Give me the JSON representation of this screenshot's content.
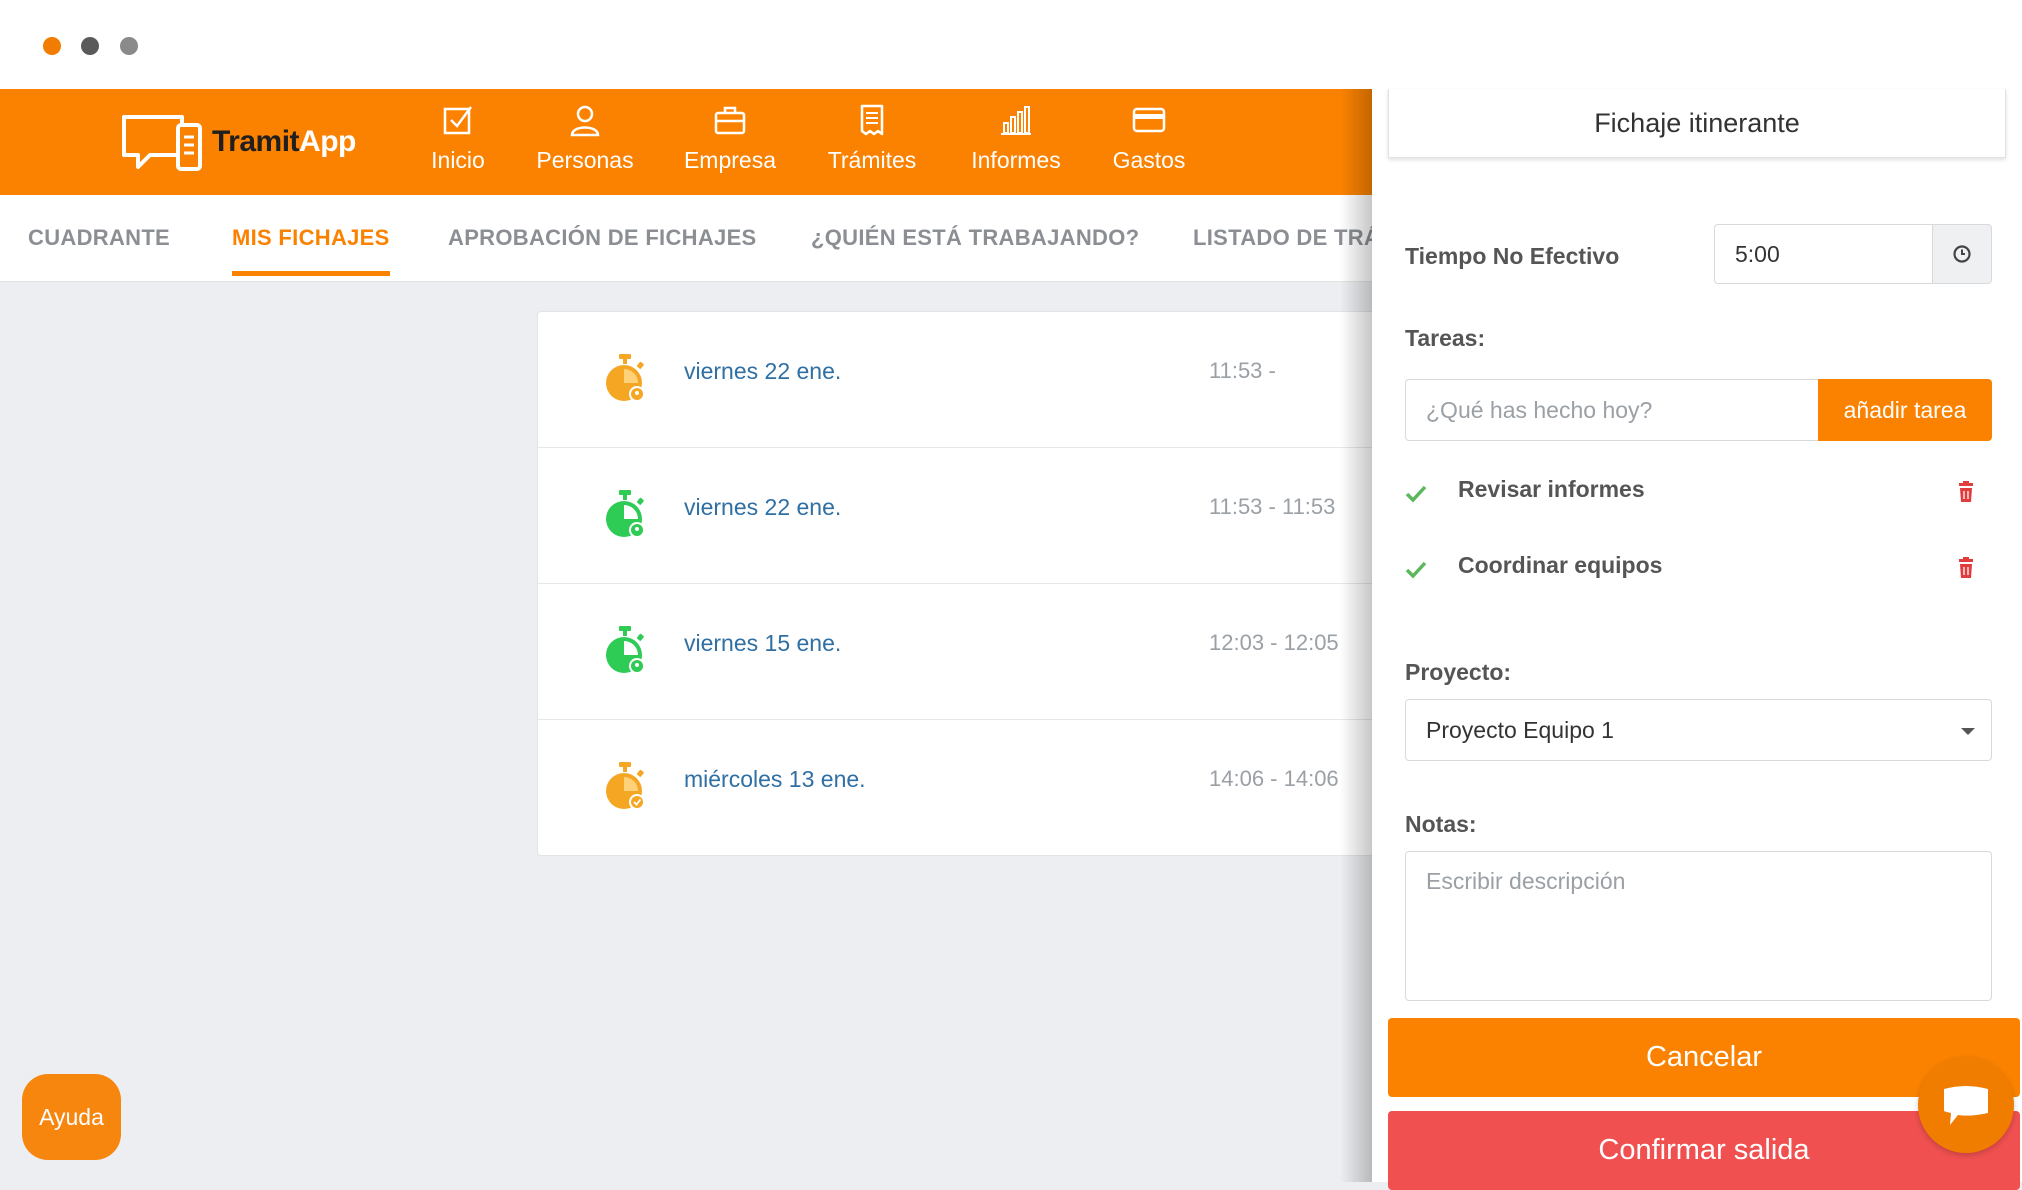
{
  "colors": {
    "accent": "#fb8200",
    "danger": "#f05050",
    "link": "#2f6fa3",
    "success": "#2ecc55",
    "warning": "#f5a623"
  },
  "brand": {
    "logo_part1": "Tramit",
    "logo_part2": "App"
  },
  "nav": [
    {
      "label": "Inicio",
      "icon": "checkbox-icon"
    },
    {
      "label": "Personas",
      "icon": "person-icon"
    },
    {
      "label": "Empresa",
      "icon": "briefcase-icon"
    },
    {
      "label": "Trámites",
      "icon": "receipt-icon"
    },
    {
      "label": "Informes",
      "icon": "bar-chart-icon"
    },
    {
      "label": "Gastos",
      "icon": "credit-card-icon"
    }
  ],
  "tabs": [
    {
      "label": "CUADRANTE",
      "active": false
    },
    {
      "label": "MIS FICHAJES",
      "active": true
    },
    {
      "label": "APROBACIÓN DE FICHAJES",
      "active": false
    },
    {
      "label": "¿QUIÉN ESTÁ TRABAJANDO?",
      "active": false
    },
    {
      "label": "LISTADO DE TRÁ",
      "active": false
    }
  ],
  "records": [
    {
      "date": "viernes 22 ene.",
      "time": "11:53 -",
      "status_icon": "stopwatch-orange-icon"
    },
    {
      "date": "viernes 22 ene.",
      "time": "11:53 - 11:53",
      "status_icon": "stopwatch-green-icon"
    },
    {
      "date": "viernes 15 ene.",
      "time": "12:03 - 12:05",
      "status_icon": "stopwatch-green-icon"
    },
    {
      "date": "miércoles 13 ene.",
      "time": "14:06 - 14:06",
      "status_icon": "stopwatch-orange-icon"
    }
  ],
  "help_label": "Ayuda",
  "panel": {
    "title": "Fichaje itinerante",
    "tiempo_label": "Tiempo No Efectivo",
    "tiempo_value": "5:00",
    "tareas_label": "Tareas:",
    "task_placeholder": "¿Qué has hecho hoy?",
    "add_task_label": "añadir tarea",
    "tasks": [
      "Revisar informes",
      "Coordinar equipos"
    ],
    "proyecto_label": "Proyecto:",
    "proyecto_value": "Proyecto Equipo 1",
    "notas_label": "Notas:",
    "notas_placeholder": "Escribir descripción",
    "cancel_label": "Cancelar",
    "confirm_label": "Confirmar salida"
  }
}
